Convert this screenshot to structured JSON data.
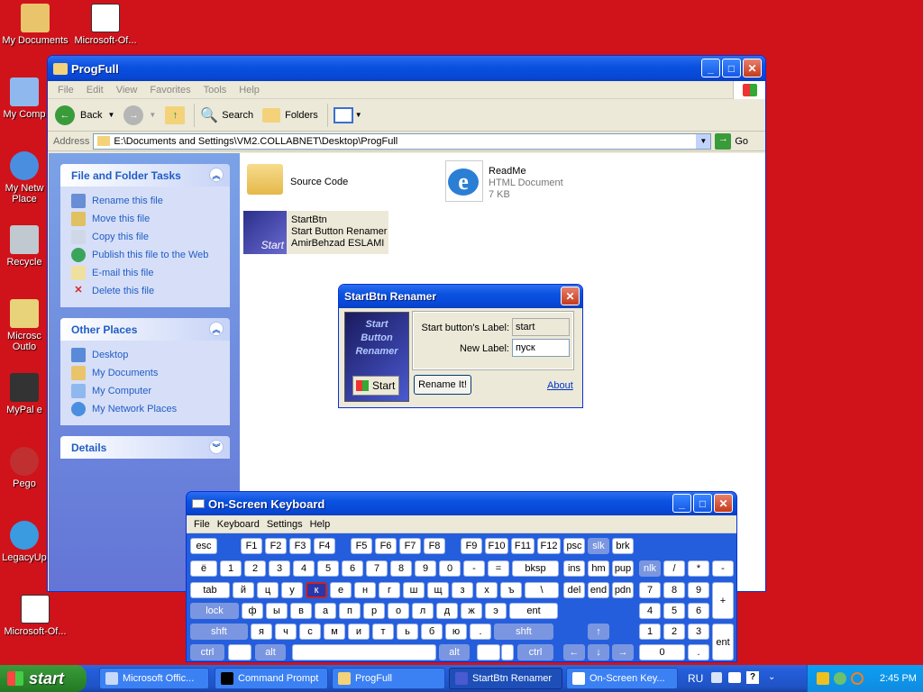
{
  "desktop_icons": [
    {
      "label": "My Documents",
      "color": "#e9c46a"
    },
    {
      "label": "Microsoft-Of...",
      "color": "#ffffff"
    },
    {
      "label": "My Comp",
      "color": "#8fb8ee"
    },
    {
      "label": "My Netw Place",
      "color": "#4a8ee0"
    },
    {
      "label": "Recycle",
      "color": "#c0c8d0"
    },
    {
      "label": "Microsc Outlo",
      "color": "#e8d27a"
    },
    {
      "label": "MyPal e",
      "color": "#333333"
    },
    {
      "label": "Pego",
      "color": "#c03030"
    },
    {
      "label": "LegacyUp",
      "color": "#3a9be0"
    },
    {
      "label": "Microsoft-Of...",
      "color": "#ffffff"
    }
  ],
  "explorer": {
    "title": "ProgFull",
    "menu": [
      "File",
      "Edit",
      "View",
      "Favorites",
      "Tools",
      "Help"
    ],
    "toolbar": {
      "back": "Back",
      "search": "Search",
      "folders": "Folders"
    },
    "address_label": "Address",
    "address_value": "E:\\Documents and Settings\\VM2.COLLABNET\\Desktop\\ProgFull",
    "go": "Go",
    "file_tasks": {
      "title": "File and Folder Tasks",
      "items": [
        "Rename this file",
        "Move this file",
        "Copy this file",
        "Publish this file to the Web",
        "E-mail this file",
        "Delete this file"
      ]
    },
    "other_places": {
      "title": "Other Places",
      "items": [
        "Desktop",
        "My Documents",
        "My Computer",
        "My Network Places"
      ]
    },
    "details": {
      "title": "Details"
    },
    "files": [
      {
        "name": "Source Code"
      },
      {
        "name": "ReadMe",
        "type": "HTML Document",
        "size": "7 KB"
      },
      {
        "name": "StartBtn",
        "desc": "Start Button Renamer",
        "author": "AmirBehzad ESLAMI",
        "icon_text": "Start"
      }
    ]
  },
  "renamer": {
    "title": "StartBtn Renamer",
    "logo_text": "Start Button Renamer",
    "logo_start": "Start",
    "label_current": "Start button's Label:",
    "value_current": "start",
    "label_new": "New Label:",
    "value_new": "пуск",
    "rename_btn": "Rename It!",
    "about": "About"
  },
  "osk": {
    "title": "On-Screen Keyboard",
    "menu": [
      "File",
      "Keyboard",
      "Settings",
      "Help"
    ],
    "rows": [
      [
        "esc",
        "F1",
        "F2",
        "F3",
        "F4",
        "F5",
        "F6",
        "F7",
        "F8",
        "F9",
        "F10",
        "F11",
        "F12",
        "psc",
        "slk",
        "brk"
      ],
      [
        "ё",
        "1",
        "2",
        "3",
        "4",
        "5",
        "6",
        "7",
        "8",
        "9",
        "0",
        "-",
        "=",
        "bksp",
        "ins",
        "hm",
        "pup",
        "nlk",
        "/",
        "*",
        "-"
      ],
      [
        "tab",
        "й",
        "ц",
        "у",
        "к",
        "е",
        "н",
        "г",
        "ш",
        "щ",
        "з",
        "х",
        "ъ",
        "\\",
        "del",
        "end",
        "pdn",
        "7",
        "8",
        "9",
        "+"
      ],
      [
        "lock",
        "ф",
        "ы",
        "в",
        "а",
        "п",
        "р",
        "о",
        "л",
        "д",
        "ж",
        "э",
        "ent",
        "4",
        "5",
        "6"
      ],
      [
        "shft",
        "я",
        "ч",
        "с",
        "м",
        "и",
        "т",
        "ь",
        "б",
        "ю",
        ".",
        "shft",
        "↑",
        "1",
        "2",
        "3",
        "ent"
      ],
      [
        "ctrl",
        "alt",
        "alt",
        "ctrl",
        "←",
        "↓",
        "→",
        "0",
        "."
      ]
    ]
  },
  "taskbar": {
    "start": "start",
    "tasks": [
      "Microsoft Offic...",
      "Command Prompt",
      "ProgFull",
      "StartBtn Renamer",
      "On-Screen Key..."
    ],
    "lang": "RU",
    "clock": "2:45 PM"
  }
}
